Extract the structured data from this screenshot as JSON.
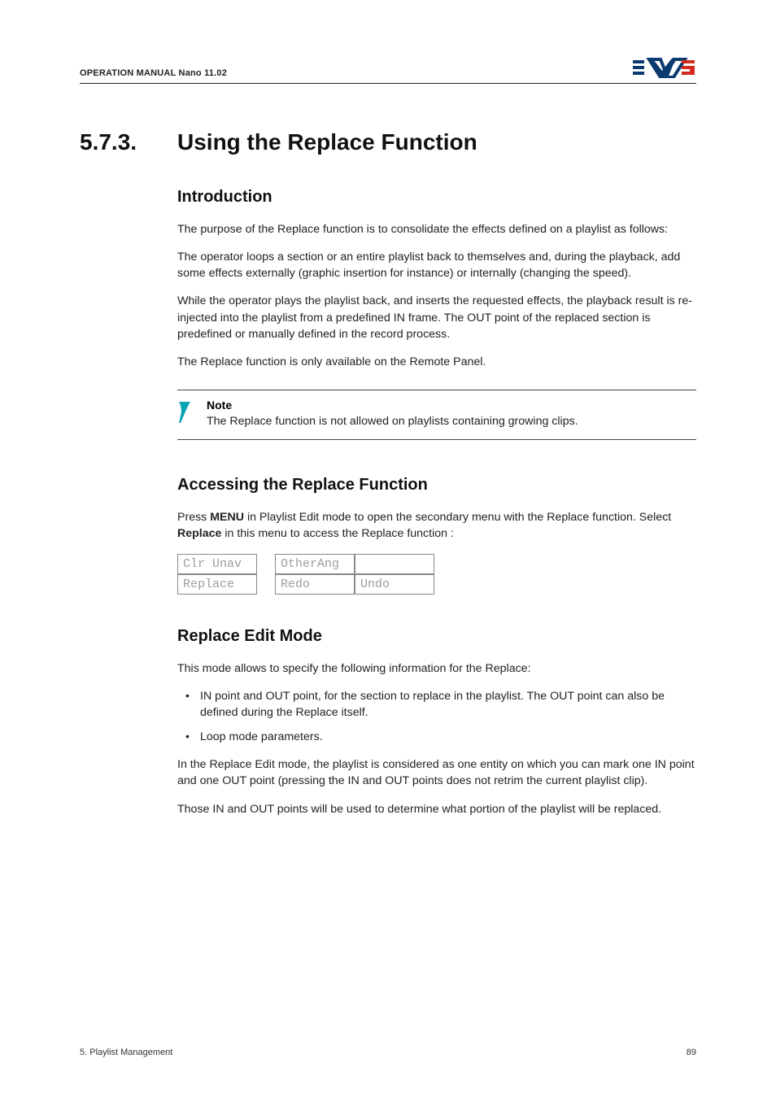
{
  "header": {
    "left": "OPERATION MANUAL Nano 11.02"
  },
  "section": {
    "number": "5.7.3.",
    "title": "Using the Replace Function"
  },
  "intro": {
    "heading": "Introduction",
    "p1": "The purpose of the Replace function is to consolidate the effects defined on a playlist as follows:",
    "p2": "The operator loops a section or an entire playlist back to themselves and, during the playback, add some effects externally (graphic insertion for instance) or internally (changing the speed).",
    "p3": "While the operator plays the playlist back, and inserts the requested effects, the playback result is re-injected into the playlist from a predefined IN frame. The OUT point of the replaced section is predefined or manually defined in the record process.",
    "p4": "The Replace function is only available on the Remote Panel."
  },
  "note": {
    "label": "Note",
    "text": "The Replace function is not allowed on playlists containing growing clips."
  },
  "access": {
    "heading": "Accessing the Replace Function",
    "p1_pre": "Press ",
    "p1_menu": "MENU",
    "p1_mid": " in Playlist Edit mode to open the secondary menu with the Replace function. Select ",
    "p1_replace": "Replace",
    "p1_post": " in this menu to access the Replace function :",
    "menu": {
      "r1c1": "Clr Unav",
      "r1c3": "OtherAng",
      "r1c4": "",
      "r2c1": "Replace",
      "r2c3": "Redo",
      "r2c4": "Undo"
    }
  },
  "editmode": {
    "heading": "Replace Edit Mode",
    "p1": "This mode allows to specify the following information for the Replace:",
    "b1": "IN point and OUT point, for the section to replace in the playlist. The OUT point can also be defined during the Replace itself.",
    "b2": "Loop mode parameters.",
    "p2": "In the Replace Edit mode, the playlist is considered as one entity on which you can mark one IN point and one OUT point (pressing the IN and OUT points does not retrim the current playlist clip).",
    "p3": "Those IN and OUT points will be used to determine what portion of the playlist will be replaced."
  },
  "footer": {
    "left": "5. Playlist Management",
    "right": "89"
  }
}
